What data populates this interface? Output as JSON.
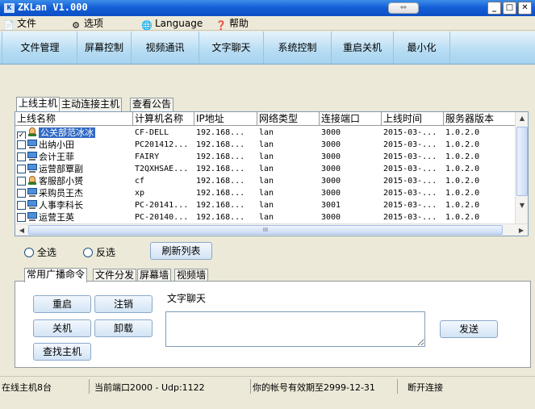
{
  "window": {
    "title": "ZKLan V1.000",
    "logo_text": "K",
    "restore_glyph": "⇔",
    "min_glyph": "_",
    "max_glyph": "□",
    "close_glyph": "✕"
  },
  "menu": [
    {
      "label": "文件",
      "icon": "file-icon",
      "glyph": "📄"
    },
    {
      "label": "选项",
      "icon": "options-icon",
      "glyph": "⚙"
    },
    {
      "label": "Language",
      "icon": "language-icon",
      "glyph": "🌐"
    },
    {
      "label": "帮助",
      "icon": "help-icon",
      "glyph": "❓"
    }
  ],
  "toolbar": [
    "文件管理",
    "屏幕控制",
    "视频通讯",
    "文字聊天",
    "系统控制",
    "重启关机",
    "最小化"
  ],
  "host_tabs": [
    "上线主机",
    "主动连接主机",
    "查看公告"
  ],
  "columns": [
    "上线名称",
    "计算机名称",
    "IP地址",
    "网络类型",
    "连接端口",
    "上线时间",
    "服务器版本"
  ],
  "hosts": [
    {
      "name": "公关部范冰冰",
      "computer": "CF-DELL",
      "ip": "192.168...",
      "net": "lan",
      "port": "3000",
      "time": "2015-03-...",
      "version": "1.0.2.0",
      "checked": true,
      "icon": "person-icon"
    },
    {
      "name": "出纳小田",
      "computer": "PC201412...",
      "ip": "192.168...",
      "net": "lan",
      "port": "3000",
      "time": "2015-03-...",
      "version": "1.0.2.0",
      "checked": false,
      "icon": "computer-icon"
    },
    {
      "name": "会计王菲",
      "computer": "FAIRY",
      "ip": "192.168...",
      "net": "lan",
      "port": "3000",
      "time": "2015-03-...",
      "version": "1.0.2.0",
      "checked": false,
      "icon": "computer-icon"
    },
    {
      "name": "运营部覃副",
      "computer": "T2QXHSAE...",
      "ip": "192.168...",
      "net": "lan",
      "port": "3000",
      "time": "2015-03-...",
      "version": "1.0.2.0",
      "checked": false,
      "icon": "computer-icon"
    },
    {
      "name": "客服部小赟",
      "computer": "cf",
      "ip": "192.168...",
      "net": "lan",
      "port": "3000",
      "time": "2015-03-...",
      "version": "1.0.2.0",
      "checked": false,
      "icon": "person-icon"
    },
    {
      "name": "采购员王杰",
      "computer": "xp",
      "ip": "192.168...",
      "net": "lan",
      "port": "3000",
      "time": "2015-03-...",
      "version": "1.0.2.0",
      "checked": false,
      "icon": "computer-icon"
    },
    {
      "name": "人事李科长",
      "computer": "PC-20141...",
      "ip": "192.168...",
      "net": "lan",
      "port": "3001",
      "time": "2015-03-...",
      "version": "1.0.2.0",
      "checked": false,
      "icon": "computer-icon"
    },
    {
      "name": "运营王英",
      "computer": "PC-20140...",
      "ip": "192.168...",
      "net": "lan",
      "port": "3000",
      "time": "2015-03-...",
      "version": "1.0.2.0",
      "checked": false,
      "icon": "computer-icon"
    }
  ],
  "scroll_thumb_glyph": "III",
  "select_all": "全选",
  "invert_select": "反选",
  "refresh_list": "刷新列表",
  "command_tabs": [
    "常用广播命令",
    "文件分发",
    "屏幕墙",
    "视频墙"
  ],
  "commands": {
    "restart": "重启",
    "logoff": "注销",
    "shutdown": "关机",
    "uninstall": "卸载",
    "find_host": "查找主机",
    "chat_label": "文字聊天",
    "send": "发送"
  },
  "status": {
    "online": "在线主机8台",
    "port": "当前端口2000 - Udp:1122",
    "account": "你的帐号有效期至2999-12-31",
    "disconnect": "断开连接"
  }
}
